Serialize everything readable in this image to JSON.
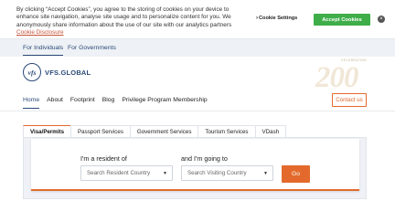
{
  "cookie_banner": {
    "text": "By clicking “Accept Cookies”, you agree to the storing of cookies on your device to enhance site navigation, analyse site usage and to personalize content for you. We anonymously share information about the use of our site with our analytics partners",
    "link": "Cookie Disclosure",
    "settings_label": "Cookie Settings",
    "accept_label": "Accept Cookies",
    "close_icon": "close-icon"
  },
  "audience": {
    "individuals": "For Individuals",
    "governments": "For Governments"
  },
  "brand": {
    "logo_mark": "vfs",
    "name": "VFS.GLOBAL",
    "anniversary_small": "CELEBRATING",
    "anniversary_big": "200"
  },
  "nav": {
    "items": [
      "Home",
      "About",
      "Footprint",
      "Blog",
      "Privilege Program Membership"
    ],
    "contact": "Contact us"
  },
  "services": {
    "tabs": [
      "Visa/Permits",
      "Passport Services",
      "Government Services",
      "Tourism Services",
      "VDash"
    ],
    "resident_label": "I'm a resident of",
    "going_label": "and I'm going to",
    "resident_placeholder": "Search Resident Country",
    "visiting_placeholder": "Search Visiting Country",
    "go_label": "Go"
  },
  "colors": {
    "brand_navy": "#2b4a78",
    "accent_orange": "#e36a2c",
    "accept_green": "#3fae49"
  }
}
